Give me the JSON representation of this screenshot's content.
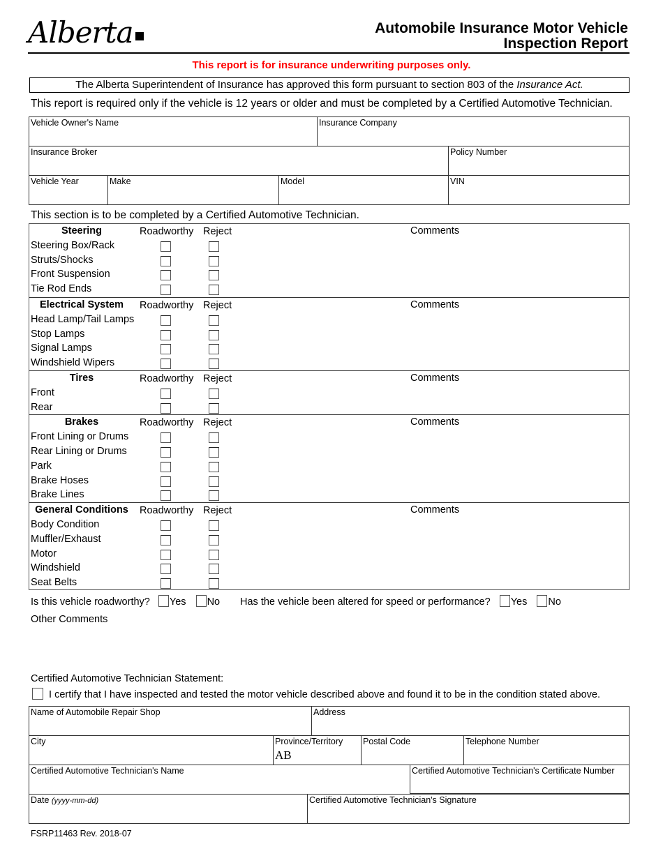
{
  "header": {
    "logo_text": "Alberta",
    "title_line1": "Automobile Insurance Motor Vehicle",
    "title_line2": "Inspection Report",
    "red_note": "This report is for insurance underwriting purposes only.",
    "red_color": "#ff0000",
    "approval_text": "The Alberta Superintendent of Insurance has approved this form pursuant to section 803 of the ",
    "approval_act": "Insurance Act.",
    "requirement": "This report is required only if the vehicle is 12 years or older and must be completed by a Certified Automotive Technician."
  },
  "vehicle_fields": {
    "owner_name": {
      "label": "Vehicle Owner's Name",
      "value": ""
    },
    "insurance_company": {
      "label": "Insurance Company",
      "value": ""
    },
    "insurance_broker": {
      "label": "Insurance Broker",
      "value": ""
    },
    "policy_number": {
      "label": "Policy Number",
      "value": ""
    },
    "vehicle_year": {
      "label": "Vehicle Year",
      "value": ""
    },
    "make": {
      "label": "Make",
      "value": ""
    },
    "model": {
      "label": "Model",
      "value": ""
    },
    "vin": {
      "label": "VIN",
      "value": ""
    }
  },
  "inspection": {
    "section_note": "This section is to be completed by a Certified Automotive Technician.",
    "col_roadworthy": "Roadworthy",
    "col_reject": "Reject",
    "col_comments": "Comments",
    "groups": [
      {
        "name": "Steering",
        "items": [
          "Steering Box/Rack",
          "Struts/Shocks",
          "Front Suspension",
          "Tie Rod Ends"
        ]
      },
      {
        "name": "Electrical System",
        "items": [
          "Head Lamp/Tail Lamps",
          "Stop Lamps",
          "Signal Lamps",
          "Windshield Wipers"
        ]
      },
      {
        "name": "Tires",
        "items": [
          "Front",
          "Rear"
        ]
      },
      {
        "name": "Brakes",
        "items": [
          "Front Lining or Drums",
          "Rear Lining or Drums",
          "Park",
          "Brake Hoses",
          "Brake Lines"
        ]
      },
      {
        "name": "General Conditions",
        "items": [
          "Body Condition",
          "Muffler/Exhaust",
          "Motor",
          "Windshield",
          "Seat Belts"
        ]
      }
    ]
  },
  "questions": {
    "roadworthy_q": "Is this vehicle roadworthy?",
    "altered_q": "Has the vehicle been altered for speed or performance?",
    "yes": "Yes",
    "no": "No",
    "other_comments": "Other Comments"
  },
  "statement": {
    "heading": "Certified Automotive Technician Statement:",
    "certify": "I certify that I have inspected and tested the motor vehicle described above and found it to be in the condition stated above."
  },
  "shop_fields": {
    "shop_name": {
      "label": "Name of Automobile Repair Shop",
      "value": ""
    },
    "address": {
      "label": "Address",
      "value": ""
    },
    "city": {
      "label": "City",
      "value": ""
    },
    "province": {
      "label": "Province/Territory",
      "value": "AB"
    },
    "postal_code": {
      "label": "Postal Code",
      "value": ""
    },
    "telephone": {
      "label": "Telephone Number",
      "value": ""
    },
    "tech_name": {
      "label": "Certified Automotive Technician's Name",
      "value": ""
    },
    "cert_number": {
      "label": "Certified Automotive Technician's Certificate Number",
      "value": ""
    },
    "date": {
      "label": "Date ",
      "hint": "(yyyy-mm-dd)",
      "value": ""
    },
    "signature": {
      "label": "Certified Automotive Technician's Signature",
      "value": ""
    }
  },
  "footer": {
    "form_id": "FSRP11463  Rev. 2018-07"
  }
}
